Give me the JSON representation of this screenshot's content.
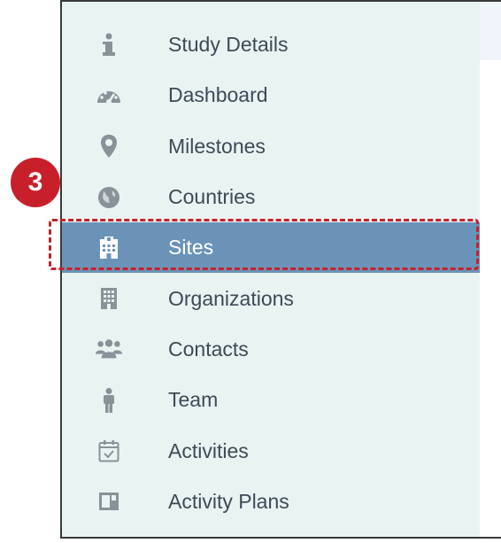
{
  "step_badge": "3",
  "menu": {
    "items": [
      {
        "label": "Study Details",
        "icon": "info-icon"
      },
      {
        "label": "Dashboard",
        "icon": "dashboard-icon"
      },
      {
        "label": "Milestones",
        "icon": "map-pin-icon"
      },
      {
        "label": "Countries",
        "icon": "globe-icon"
      },
      {
        "label": "Sites",
        "icon": "hospital-icon",
        "active": true
      },
      {
        "label": "Organizations",
        "icon": "building-icon"
      },
      {
        "label": "Contacts",
        "icon": "users-icon"
      },
      {
        "label": "Team",
        "icon": "person-icon"
      },
      {
        "label": "Activities",
        "icon": "calendar-check-icon"
      },
      {
        "label": "Activity Plans",
        "icon": "layout-icon"
      }
    ]
  },
  "colors": {
    "active_bg": "#6a93b7",
    "nav_bg": "#e9f3f2",
    "icon_gray": "#8a9198",
    "annotation_red": "#c8202b"
  }
}
